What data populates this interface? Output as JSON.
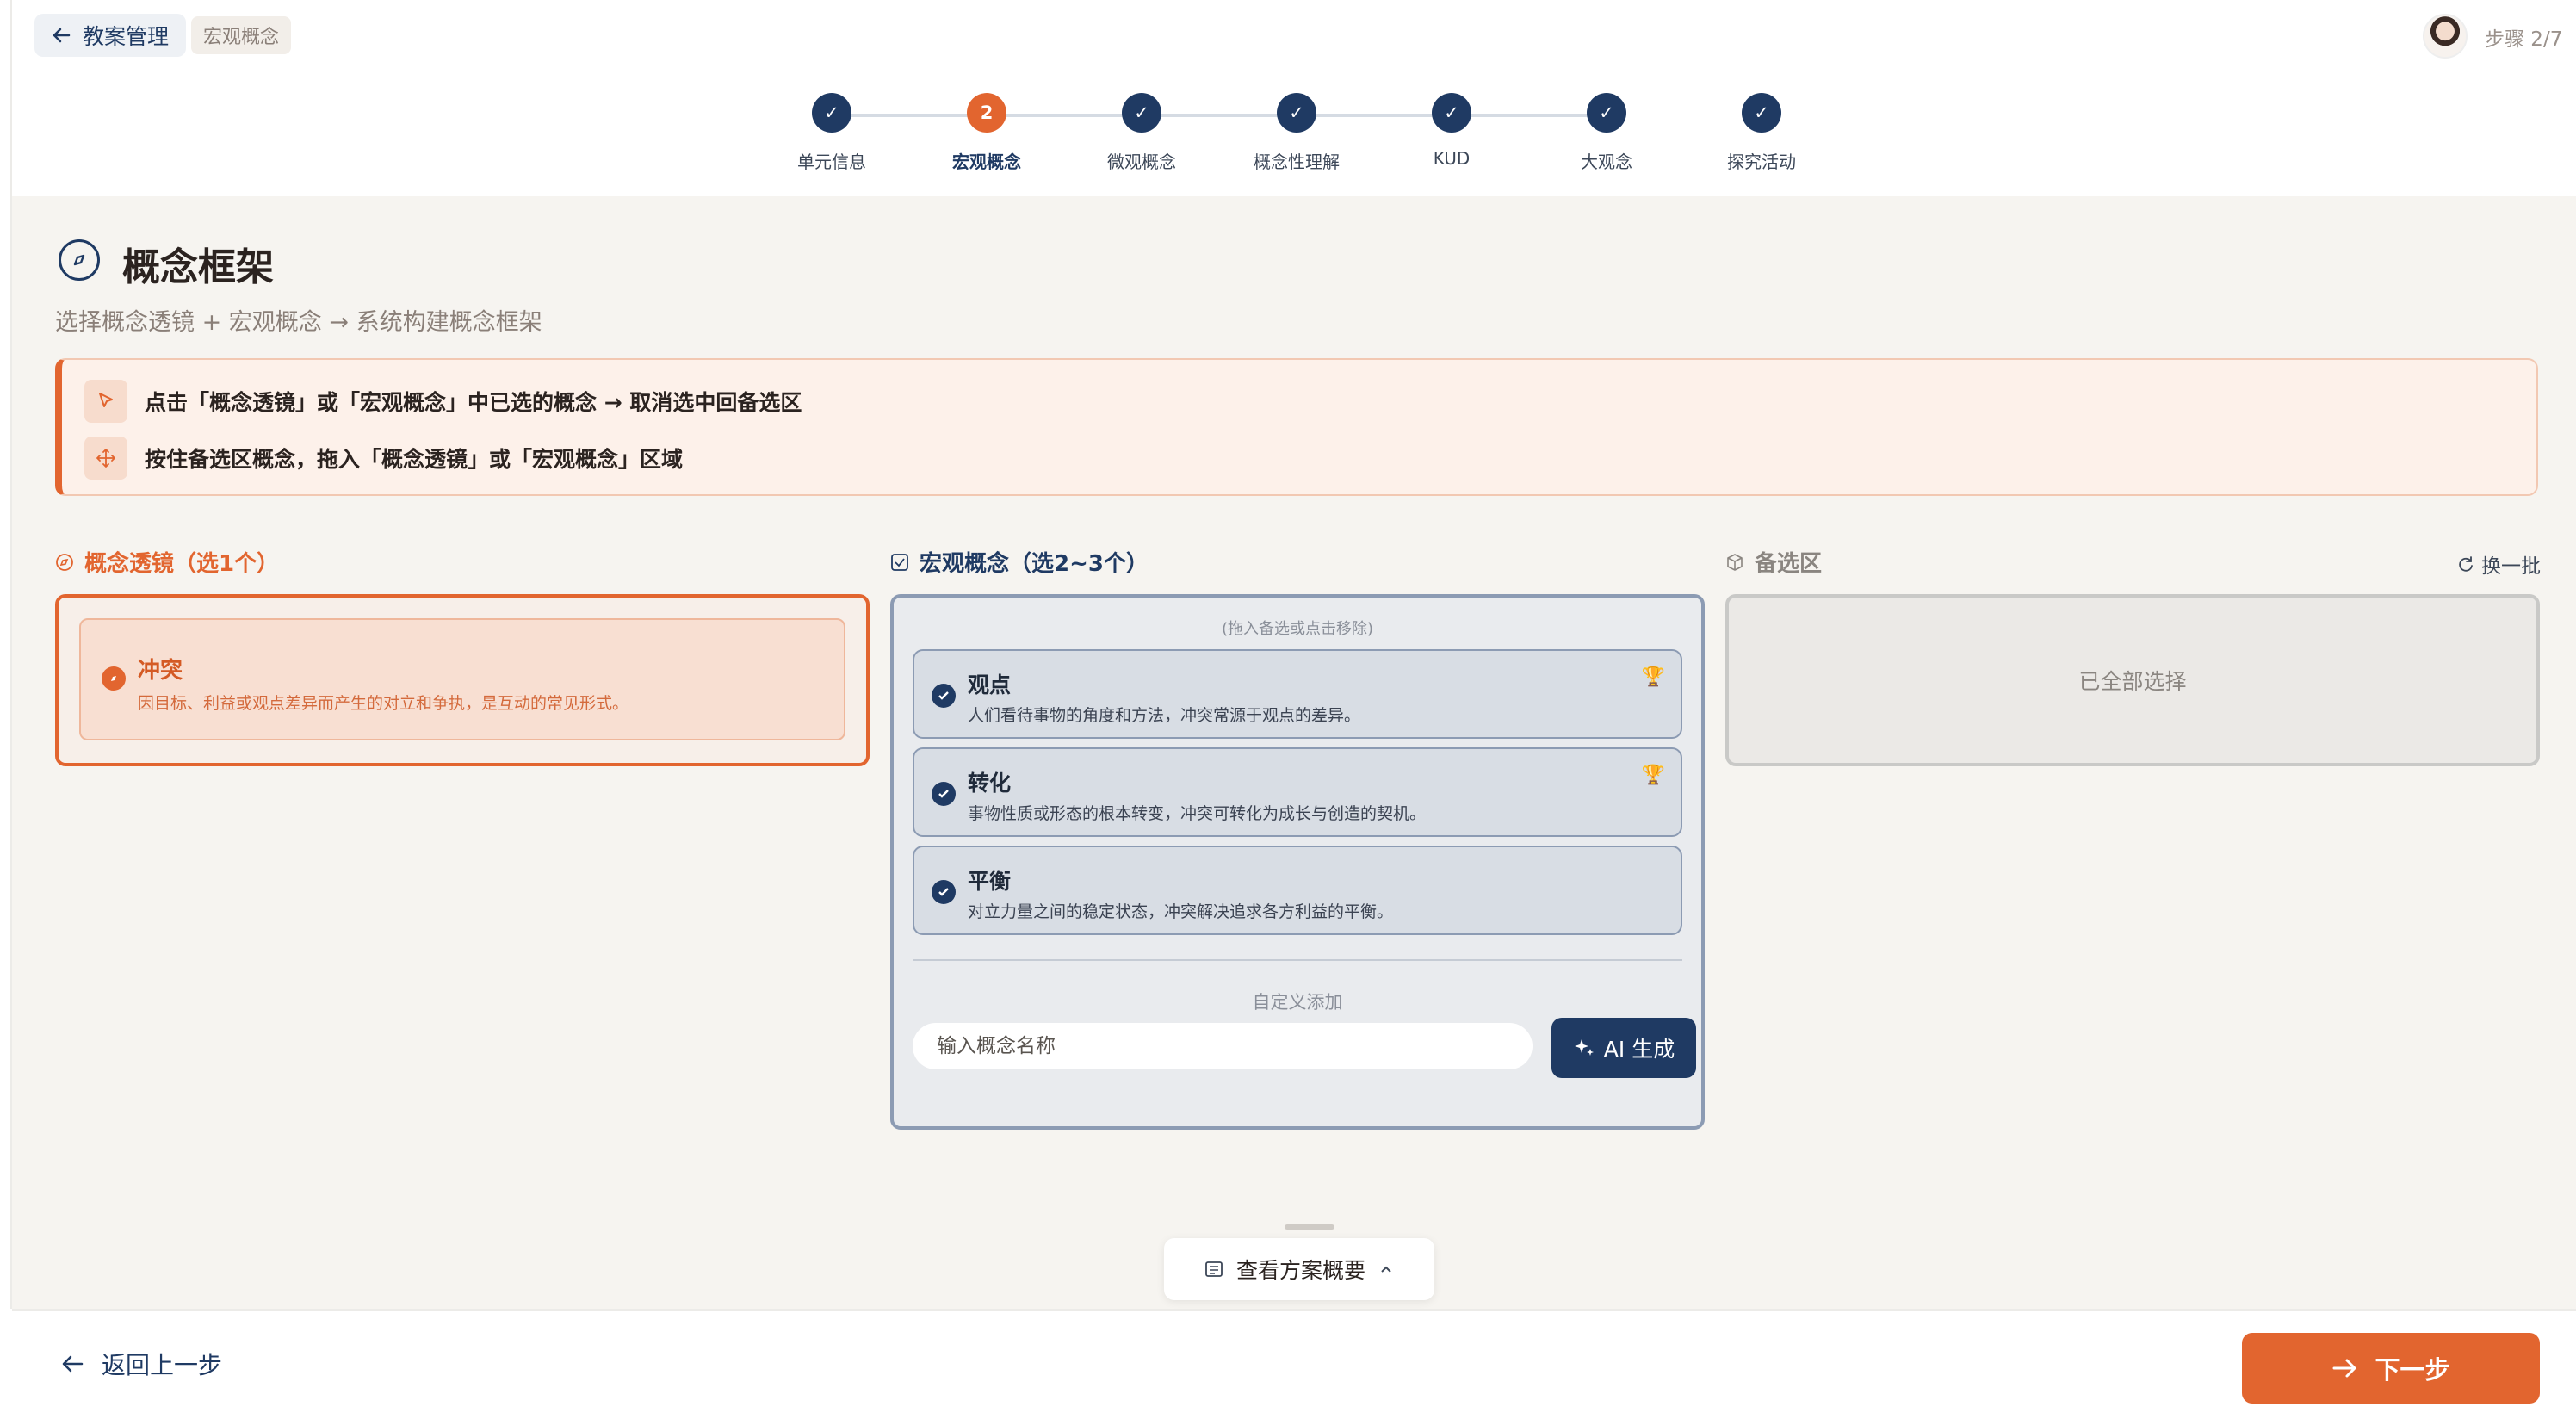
{
  "header": {
    "back_label": "教案管理",
    "breadcrumb": "宏观概念",
    "step_indicator": "步骤 2/7",
    "colors": {
      "primary": "#1f3a63",
      "accent": "#e2652f"
    }
  },
  "stepper": {
    "steps": [
      {
        "label": "单元信息",
        "state": "done",
        "number": ""
      },
      {
        "label": "宏观概念",
        "state": "active",
        "number": "2"
      },
      {
        "label": "微观概念",
        "state": "done",
        "number": ""
      },
      {
        "label": "概念性理解",
        "state": "done",
        "number": ""
      },
      {
        "label": "KUD",
        "state": "done",
        "number": ""
      },
      {
        "label": "大观念",
        "state": "done",
        "number": ""
      },
      {
        "label": "探究活动",
        "state": "done",
        "number": ""
      }
    ]
  },
  "main": {
    "title": "概念框架",
    "title_icon": "compass-icon",
    "subtitle": "选择概念透镜 + 宏观概念 → 系统构建概念框架",
    "tips": [
      {
        "icon": "pointer-icon",
        "text": "点击「概念透镜」或「宏观概念」中已选的概念 → 取消选中回备选区"
      },
      {
        "icon": "move-icon",
        "text": "按住备选区概念，拖入「概念透镜」或「宏观概念」区域"
      }
    ]
  },
  "lens": {
    "heading": "概念透镜（选1个）",
    "selected": [
      {
        "name": "冲突",
        "desc": "因目标、利益或观点差异而产生的对立和争执，是互动的常见形式。"
      }
    ]
  },
  "macro": {
    "heading": "宏观概念（选2~3个）",
    "drag_hint": "(拖入备选或点击移除)",
    "selected": [
      {
        "name": "观点",
        "desc": "人们看待事物的角度和方法，冲突常源于观点的差异。",
        "badge": "trophy-icon"
      },
      {
        "name": "转化",
        "desc": "事物性质或形态的根本转变，冲突可转化为成长与创造的契机。",
        "badge": "trophy-icon"
      },
      {
        "name": "平衡",
        "desc": "对立力量之间的稳定状态，冲突解决追求各方利益的平衡。",
        "badge": ""
      }
    ],
    "custom_label": "自定义添加",
    "input_placeholder": "输入概念名称",
    "input_value": "",
    "ai_button": "AI 生成"
  },
  "pool": {
    "heading": "备选区",
    "refresh_label": "换一批",
    "empty_text": "已全部选择"
  },
  "summary_button": "查看方案概要",
  "footer": {
    "prev_label": "返回上一步",
    "next_label": "下一步"
  }
}
